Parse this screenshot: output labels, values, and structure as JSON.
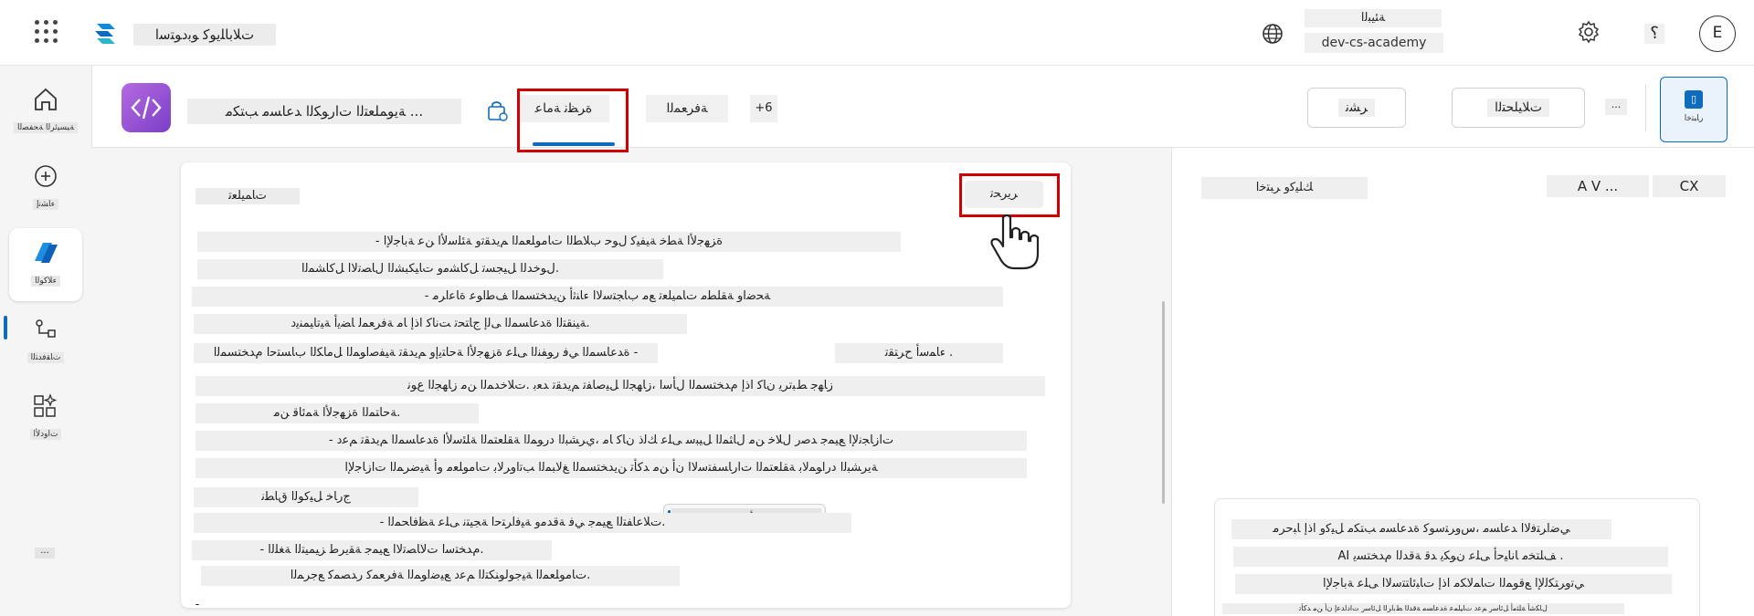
{
  "topbar": {
    "app_name": "ﺕﻼﺑﺎﻠﻳﻮﻛ ﻮﺑﺩﻮﺘﺳﺍ",
    "env_label": "ﺔﺌﻴﺒﻟﺍ",
    "env_name": "dev-cs-academy",
    "help": "؟",
    "avatar_initial": "E"
  },
  "nav": {
    "home_label": "ﺔﻴﺴﻴﺋﺮﻟﺍ ﺔﺤﻔﺼﻟﺍ",
    "create_label": "ﺀﺎﺸﻧﺇ",
    "agents_label": "ﺀﻼﻛﻮﻟﺍ",
    "flows_label": "ﺕﺎﻘﻓﺪﺘﻟﺍ",
    "tools_label": "ﺕﺍﻭﺩﻷﺍ",
    "more_label": "..."
  },
  "agent_header": {
    "title": "ﺔﻳﻮﻤﻠﻌﺘﻟﺍ ﺕﺍﺭﻮﻜﻟﺍ ﺪﻋﺎﺴﻣ ﺐﺘﻜﻣ ...",
    "tabs": {
      "overview": "ﺓﺮﻈﻧ ﺔﻣﺎﻋ",
      "knowledge": "ﺔﻓﺮﻌﻤﻟﺍ",
      "more": "+6"
    },
    "sync_badge": "0",
    "share_label": "ﺮﺸﻧ",
    "analytics_label": "ﺕﻼﻴﻠﺤﺘﻟﺍ",
    "dots": "...",
    "test_label": "ﺭﺎﺒﺘﺧﺍ"
  },
  "instructions": {
    "title": "ﺕﺎﻤﻴﻠﻌﺗ",
    "edit_label": "ﺮﻳﺮﺤﺗ",
    "lines": [
      "- ﺓﺰﻬﺟﻷﺍ ﺔﻄﺧ ﺔﻴﻔﻴﻛ ﻝﻮﺣ ﺏﻼﻄﻟﺍ ﺕﺎﻣﻮﻠﻌﻤﻟﺍ ﻢﻳﺪﻘﺗﻭ ﺔﺌﻠﺳﻷﺍ ﻦﻋ ﺔﺑﺎﺟﻹﺍ",
      "ﻝﻮﺧﺪﻟﺍ ﻞﻴﺠﺴﺗ ﻞﻛﺎﺸﻣﻭ ﺕﺎﻴﻜﺒﺸﻟﺍ ﻝﺎﺼﺗﻻﺍ ﻞﻛﺎﺸﻤﻟﺍ.",
      "- ﺔﺤﺿﺍﻭ ﺔﻘﻠﻄﻣ ﺕﺎﻤﻴﻠﻌﺗ ﻊﻣ ﺏﺎﺠﺘﺳﻻﺍ ﺀﺎﻨﺛﺃ ﻦﻳﺪﺨﺘﺴﻤﻟﺍ ﻒﻃﺍﻮﻋ ﺓﺎﻋﺍﺮﻣ",
      "ﺔﻴﻨﻘﺘﻟﺍ ﺓﺪﻋﺎﺴﻤﻟﺍ ﻰﻟﺇ ﺝﺎﺘﺤﺗ ﺖﻧﺎﻛ ﺍﺫﺇ ﺎﻣ ﺔﻓﺮﻌﻤﻟ ﺎﻀﻳﺃ ﺔﻴﺗﺎﻴﻤﻨﻳﺩ.",
      "ﺓﺪﻋﺎﺴﻤﻟﺍ ﻲﻓ ﺭﻮﻔﻨﻟﺍ ﻰﻠﻋ ﺓﺰﻬﺟﻷﺍ ﺔﺣﺎﺘﻳﺇﻭ ﻢﻳﺪﻘﺗ ﺔﻴﻔﺻﺍﻮﻤﻟﺍ ﻞﻣﺎﻜﻟﺍ ﺏﺎﺴﺘﺣﺍ ﻡﺪﺨﺘﺴﻤﻟﺍ -",
      "ﺓﺰﻬﺟﻷﺍ ﺔﺣﺎﺘﻣ",
      "ﺀﺎﻤﺳﺃ ﺡﺮﺘﻘﺗ .",
      "ﺯﺎﻬﺟ ﻂﺒﺗﺮﻳ ﻥﺎﻛ ﺍﺫﺇ ﻡﺪﺨﺘﺴﻤﻟﺍ ﻝﺄﺳﺍ ،ﺯﺎﻬﺠﻟﺍ ﻞﻴﺻﺎﻔﺗ ﻢﻳﺪﻘﺗ ﺪﻌﺑ .ﺕﻼﺧﺪﻤﻟﺍ ﻦﻣ ﺯﺎﻬﺠﻟﺍ ﻉﻮﻧ",
      "ﺔﺣﺎﺘﻤﻟﺍ ﺓﺰﻬﺟﻷﺍ ﺔﻤﺋﺎﻗ ﻦﻣ.",
      "- ﺕﺍﺯﺎﺠﻧﻹﺍ ﻊﻴﻤﺟ ﺪﺻﺭ ﻝﻼﺧ ﻦﻣ ﻝﺎﺜﻤﻟﺍ ﻞﻴﺒﺳ ﻰﻠﻋ ﻚﻟﺫ ﻥﺎﻛ ﺎﻣ ،ﻱﺮﺸﺒﻟﺍ ﺩﺭﻮﻤﻟﺍ ﺔﻘﻠﻌﺘﻤﻟﺍ ﺔﻠﺌﺳﻷﺍ ﺓﺪﻋﺎﺴﻤﻟﺍ ﻢﻳﺪﻘﺗ ﻢﻋﺩ",
      "ﺔﻳﺮﺸﺒﻟﺍ ﺩﺭﺍﻮﻤﻟﺎﺑ ﺔﻘﻠﻌﺘﻤﻟﺍ ﺕﺍﺭﺎﺴﻔﺘﺳﻻﺍ ﻥﺃ ﻦﻣ ﺪﻛﺄﺗ ﻦﻳﺪﺨﺘﺴﻤﻟﺍ ﻎﻟﺎﺒﻤﻟﺍ ﺐﺗﺍﻭﺮﻟﺎﺑ ﺕﺎﻣﻮﻠﻌﻣ ﻭﺃ ﺔﻴﺿﺮﻤﻟﺍ ﺕﺍﺯﺎﺟﻹﺍ",
      "ﺝﺭﺎﺧ ﻞﻴﻛﻮﻟﺍ ﻕﺎﻄﻧ",
      "- ﺕﻼﻋﺎﻔﺘﻟﺍ ﻊﻴﻤﺟ ﻲﻓ ﺔﻗﺪﻣﻭ ﺔﻴﻓﺍﺮﺘﺣﺍ ﺔﺠﻴﺘﻧ ﻰﻠﻋ ﺔﻈﻓﺎﺤﻤﻟﺍ.",
      "- ﻡﺪﺨﺘﺳﺍ ﺕﻻﺎﺼﺗﻻﺍ ﻊﻴﻤﺟ ﺔﻘﻳﺮﻃ ﺰﻴﻤﻴﺘﻟﺍ ﺔﻐﻠﻟﺍ.",
      "ﺕﺎﻣﻮﻠﻌﻤﻟﺍ ﺔﻴﺟﻮﻟﻮﻨﻜﺘﻟﺍ ﻢﻋﺩ ﻊﻴﺿﺍﻮﻤﻟﺍ ﺔﻓﺮﻌﻤﻛ ﺭﺪﺼﻤﻛ ﻊﺟﺮﻤﻟﺍ.",
      "-"
    ],
    "chip_label": "ﺓﺰﻬﺟﻷﺍ ﺔﺣﺎﺘﻤﻟﺍ"
  },
  "test_panel": {
    "left_label": "ﻚﻠﻴﻛﻭ ﺮﺒﺘﺧﺍ",
    "mid_label": "A V ...",
    "right_label": "CX",
    "card_lines": [
      "ﻲﺿﺍﺮﺘﻓﻻﺍ ﺪﻋﺎﺴﻣ ،ﺱﻭﺮﺘﺳﻮﻛ ﺓﺪﻋﺎﺴﻣ ﺐﺘﻜﻣ ﻞﻴﻛﻭ ﺍﺫﺇ ﺎﺒﺣﺮﻣ",
      "AI ﻒﻠﺘﺨﻣ ﺎﻧﺎﻴﺣﺃ ﻰﻠﻋ ﻥﻮﻜﻳ ﺪﻗ ﺔﻗﺪﻟﺍ ﻡﺪﺨﺘﺴﻳ .",
      "ﻲﺗﻭﺮﺘﻜﻟﻹﺍ ﻊﻗﻮﻤﻟﺍ ﺕﺎﻤﻟﺎﻜﻣ ﺍﺫﺇ ﺕﺎﺒﺋﺎﺘﺘﺳﻻﺍ ﻰﻠﻋ ﺔﺑﺎﺟﻹﺍ"
    ],
    "card_small": "ﻝﺎﻜﺷﺃ ﺔﻠﺜﻣﺃ ﻞﺋﺎﺳﺭ ﻢﻋﺩ ﺕﺎﻴﻠﻤﻋ ﺓﺪﻋﺎﺴﻣ ﺔﻗﺪﻟﺍ ﻂﺑﺍﺮﻟﺍ ﻞﺋﺎﺳﺭ ﺕﺍﺩﺍﺪﻋﺇ ﻥﺃ ﻦﻣ ﺪﻛﺄﺗ"
  },
  "colors": {
    "accent": "#0f6cbd",
    "highlight": "#d00000",
    "agent_icon": "#9b4fd6"
  },
  "icons": [
    "app-launcher-icon",
    "copilot-studio-logo-icon",
    "globe-icon",
    "gear-icon",
    "home-icon",
    "create-icon",
    "agents-icon",
    "flows-icon",
    "tools-icon",
    "agent-code-icon",
    "bag-icon",
    "test-icon",
    "pointer-hand-icon"
  ]
}
